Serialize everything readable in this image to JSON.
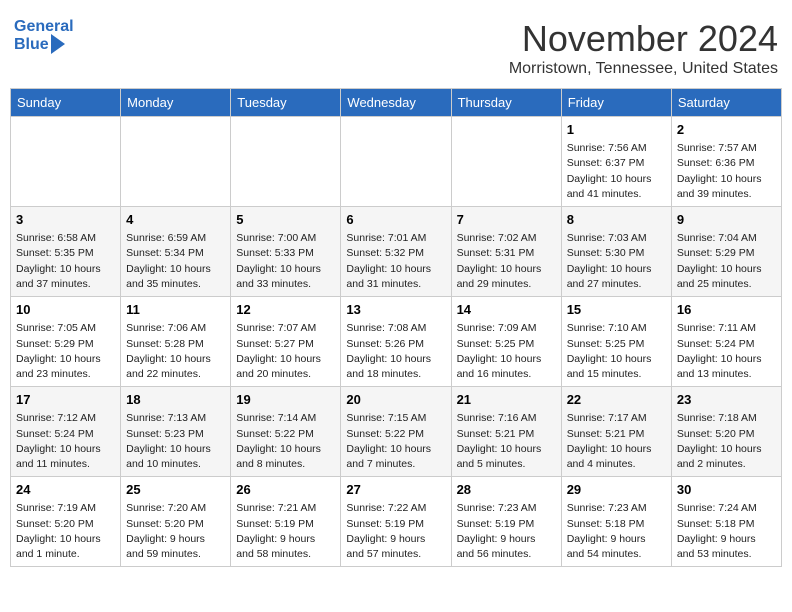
{
  "header": {
    "logo_line1": "General",
    "logo_line2": "Blue",
    "month_title": "November 2024",
    "location": "Morristown, Tennessee, United States"
  },
  "days_of_week": [
    "Sunday",
    "Monday",
    "Tuesday",
    "Wednesday",
    "Thursday",
    "Friday",
    "Saturday"
  ],
  "weeks": [
    [
      {
        "day": "",
        "info": ""
      },
      {
        "day": "",
        "info": ""
      },
      {
        "day": "",
        "info": ""
      },
      {
        "day": "",
        "info": ""
      },
      {
        "day": "",
        "info": ""
      },
      {
        "day": "1",
        "info": "Sunrise: 7:56 AM\nSunset: 6:37 PM\nDaylight: 10 hours\nand 41 minutes."
      },
      {
        "day": "2",
        "info": "Sunrise: 7:57 AM\nSunset: 6:36 PM\nDaylight: 10 hours\nand 39 minutes."
      }
    ],
    [
      {
        "day": "3",
        "info": "Sunrise: 6:58 AM\nSunset: 5:35 PM\nDaylight: 10 hours\nand 37 minutes."
      },
      {
        "day": "4",
        "info": "Sunrise: 6:59 AM\nSunset: 5:34 PM\nDaylight: 10 hours\nand 35 minutes."
      },
      {
        "day": "5",
        "info": "Sunrise: 7:00 AM\nSunset: 5:33 PM\nDaylight: 10 hours\nand 33 minutes."
      },
      {
        "day": "6",
        "info": "Sunrise: 7:01 AM\nSunset: 5:32 PM\nDaylight: 10 hours\nand 31 minutes."
      },
      {
        "day": "7",
        "info": "Sunrise: 7:02 AM\nSunset: 5:31 PM\nDaylight: 10 hours\nand 29 minutes."
      },
      {
        "day": "8",
        "info": "Sunrise: 7:03 AM\nSunset: 5:30 PM\nDaylight: 10 hours\nand 27 minutes."
      },
      {
        "day": "9",
        "info": "Sunrise: 7:04 AM\nSunset: 5:29 PM\nDaylight: 10 hours\nand 25 minutes."
      }
    ],
    [
      {
        "day": "10",
        "info": "Sunrise: 7:05 AM\nSunset: 5:29 PM\nDaylight: 10 hours\nand 23 minutes."
      },
      {
        "day": "11",
        "info": "Sunrise: 7:06 AM\nSunset: 5:28 PM\nDaylight: 10 hours\nand 22 minutes."
      },
      {
        "day": "12",
        "info": "Sunrise: 7:07 AM\nSunset: 5:27 PM\nDaylight: 10 hours\nand 20 minutes."
      },
      {
        "day": "13",
        "info": "Sunrise: 7:08 AM\nSunset: 5:26 PM\nDaylight: 10 hours\nand 18 minutes."
      },
      {
        "day": "14",
        "info": "Sunrise: 7:09 AM\nSunset: 5:25 PM\nDaylight: 10 hours\nand 16 minutes."
      },
      {
        "day": "15",
        "info": "Sunrise: 7:10 AM\nSunset: 5:25 PM\nDaylight: 10 hours\nand 15 minutes."
      },
      {
        "day": "16",
        "info": "Sunrise: 7:11 AM\nSunset: 5:24 PM\nDaylight: 10 hours\nand 13 minutes."
      }
    ],
    [
      {
        "day": "17",
        "info": "Sunrise: 7:12 AM\nSunset: 5:24 PM\nDaylight: 10 hours\nand 11 minutes."
      },
      {
        "day": "18",
        "info": "Sunrise: 7:13 AM\nSunset: 5:23 PM\nDaylight: 10 hours\nand 10 minutes."
      },
      {
        "day": "19",
        "info": "Sunrise: 7:14 AM\nSunset: 5:22 PM\nDaylight: 10 hours\nand 8 minutes."
      },
      {
        "day": "20",
        "info": "Sunrise: 7:15 AM\nSunset: 5:22 PM\nDaylight: 10 hours\nand 7 minutes."
      },
      {
        "day": "21",
        "info": "Sunrise: 7:16 AM\nSunset: 5:21 PM\nDaylight: 10 hours\nand 5 minutes."
      },
      {
        "day": "22",
        "info": "Sunrise: 7:17 AM\nSunset: 5:21 PM\nDaylight: 10 hours\nand 4 minutes."
      },
      {
        "day": "23",
        "info": "Sunrise: 7:18 AM\nSunset: 5:20 PM\nDaylight: 10 hours\nand 2 minutes."
      }
    ],
    [
      {
        "day": "24",
        "info": "Sunrise: 7:19 AM\nSunset: 5:20 PM\nDaylight: 10 hours\nand 1 minute."
      },
      {
        "day": "25",
        "info": "Sunrise: 7:20 AM\nSunset: 5:20 PM\nDaylight: 9 hours\nand 59 minutes."
      },
      {
        "day": "26",
        "info": "Sunrise: 7:21 AM\nSunset: 5:19 PM\nDaylight: 9 hours\nand 58 minutes."
      },
      {
        "day": "27",
        "info": "Sunrise: 7:22 AM\nSunset: 5:19 PM\nDaylight: 9 hours\nand 57 minutes."
      },
      {
        "day": "28",
        "info": "Sunrise: 7:23 AM\nSunset: 5:19 PM\nDaylight: 9 hours\nand 56 minutes."
      },
      {
        "day": "29",
        "info": "Sunrise: 7:23 AM\nSunset: 5:18 PM\nDaylight: 9 hours\nand 54 minutes."
      },
      {
        "day": "30",
        "info": "Sunrise: 7:24 AM\nSunset: 5:18 PM\nDaylight: 9 hours\nand 53 minutes."
      }
    ]
  ]
}
